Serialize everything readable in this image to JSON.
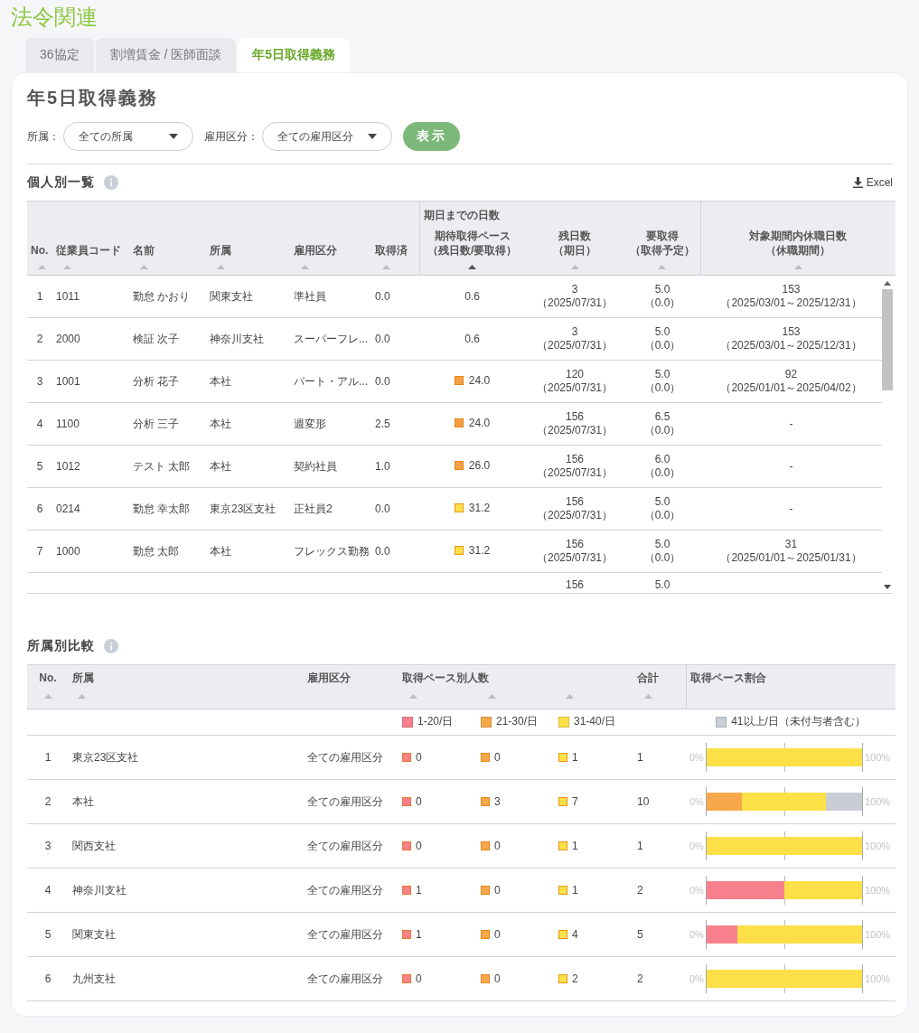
{
  "page_title": "法令関連",
  "tabs": [
    {
      "label": "36協定",
      "selected": false
    },
    {
      "label": "割増賃金 / 医師面談",
      "selected": false
    },
    {
      "label": "年5日取得義務",
      "selected": true
    }
  ],
  "heading": "年5日取得義務",
  "filters": [
    {
      "label": "所属：",
      "value": "全ての所属"
    },
    {
      "label": "雇用区分：",
      "value": "全ての雇用区分"
    }
  ],
  "show_button": "表示",
  "individual": {
    "title": "個人別一覧",
    "export": "Excel",
    "group_header": "期日までの日数",
    "columns": [
      {
        "lines": [
          "No."
        ],
        "sorted": false
      },
      {
        "lines": [
          "従業員コード"
        ],
        "sorted": false
      },
      {
        "lines": [
          "名前"
        ],
        "sorted": false
      },
      {
        "lines": [
          "所属"
        ],
        "sorted": false
      },
      {
        "lines": [
          "雇用区分"
        ],
        "sorted": false
      },
      {
        "lines": [
          "取得済"
        ],
        "sorted": false
      },
      {
        "lines": [
          "期待取得ペース",
          "（残日数/要取得）"
        ],
        "sorted": true
      },
      {
        "lines": [
          "残日数",
          "（期日）"
        ],
        "sorted": false
      },
      {
        "lines": [
          "要取得",
          "（取得予定）"
        ],
        "sorted": false
      },
      {
        "lines": [
          "対象期間内休職日数",
          "（休職期間）"
        ],
        "sorted": false
      }
    ],
    "rows": [
      {
        "no": "1",
        "code": "1011",
        "name": "勤怠 かおり",
        "dept": "関東支社",
        "type": "準社員",
        "taken": "0.0",
        "pace": "0.6",
        "remaining": "3",
        "due": "（2025/07/31）",
        "required": "5.0",
        "planned": "（0.0）",
        "leave_days": "153",
        "leave_period": "（2025/03/01～2025/12/31）"
      },
      {
        "no": "2",
        "code": "2000",
        "name": "検証 次子",
        "dept": "神奈川支社",
        "type": "スーパーフレ...",
        "taken": "0.0",
        "pace": "0.6",
        "remaining": "3",
        "due": "（2025/07/31）",
        "required": "5.0",
        "planned": "（0.0）",
        "leave_days": "153",
        "leave_period": "（2025/03/01～2025/12/31）"
      },
      {
        "no": "3",
        "code": "1001",
        "name": "分析 花子",
        "dept": "本社",
        "type": "パート・アル...",
        "taken": "0.0",
        "pace": "24.0",
        "color": "#f5a044",
        "remaining": "120",
        "due": "（2025/07/31）",
        "required": "5.0",
        "planned": "（0.0）",
        "leave_days": "92",
        "leave_period": "（2025/01/01～2025/04/02）"
      },
      {
        "no": "4",
        "code": "1100",
        "name": "分析 三子",
        "dept": "本社",
        "type": "週変形",
        "taken": "2.5",
        "pace": "24.0",
        "color": "#f5a044",
        "remaining": "156",
        "due": "（2025/07/31）",
        "required": "6.5",
        "planned": "（0.0）",
        "leave_days": "-"
      },
      {
        "no": "5",
        "code": "1012",
        "name": "テスト 太郎",
        "dept": "本社",
        "type": "契約社員",
        "taken": "1.0",
        "pace": "26.0",
        "color": "#f5a044",
        "remaining": "156",
        "due": "（2025/07/31）",
        "required": "6.0",
        "planned": "（0.0）",
        "leave_days": "-"
      },
      {
        "no": "6",
        "code": "0214",
        "name": "勤怠 幸太郎",
        "dept": "東京23区支社",
        "type": "正社員2",
        "taken": "0.0",
        "pace": "31.2",
        "color": "#fde047",
        "remaining": "156",
        "due": "（2025/07/31）",
        "required": "5.0",
        "planned": "（0.0）",
        "leave_days": "-"
      },
      {
        "no": "7",
        "code": "1000",
        "name": "勤怠 太郎",
        "dept": "本社",
        "type": "フレックス勤務",
        "taken": "0.0",
        "pace": "31.2",
        "color": "#fde047",
        "remaining": "156",
        "due": "（2025/07/31）",
        "required": "5.0",
        "planned": "（0.0）",
        "leave_days": "31",
        "leave_period": "（2025/01/01～2025/01/31）"
      },
      {
        "remaining": "156",
        "required": "5.0"
      }
    ]
  },
  "by_department": {
    "title": "所属別比較",
    "columns": [
      {
        "label": "No.",
        "sortable": true
      },
      {
        "label": "所属",
        "sortable": true
      },
      {
        "label": "雇用区分",
        "sortable": false
      },
      {
        "label": "取得ペース別人数",
        "sortable": true
      },
      {
        "sortable": true
      },
      {
        "sortable": true
      },
      {
        "label": "合計",
        "sortable": true
      },
      {
        "label": "取得ペース割合",
        "sortable": false
      }
    ],
    "legend": [
      {
        "label": "1-20/日",
        "color": "#f7808c"
      },
      {
        "label": "21-30/日",
        "color": "#f7a84a"
      },
      {
        "label": "31-40/日",
        "color": "#fde047"
      },
      {
        "label": "41以上/日（未付与者含む）",
        "color": "#c9ced6"
      }
    ],
    "rows": [
      {
        "no": "1",
        "dept": "東京23区支社",
        "type": "全ての雇用区分",
        "counts": [
          "0",
          "0",
          "1"
        ],
        "total": "1",
        "scale_min": "0%",
        "scale_max": "100%",
        "bar": [
          {
            "level": 1,
            "color": "#fde047"
          }
        ]
      },
      {
        "no": "2",
        "dept": "本社",
        "type": "全ての雇用区分",
        "counts": [
          "0",
          "3",
          "7"
        ],
        "total": "10",
        "scale_min": "0%",
        "scale_max": "100%",
        "bar": [
          {
            "level": 0.23,
            "color": "#f7a84a"
          },
          {
            "level": 0.77,
            "color": "#fde047"
          },
          {
            "level": 1,
            "color": "#c9ced6"
          }
        ]
      },
      {
        "no": "3",
        "dept": "関西支社",
        "type": "全ての雇用区分",
        "counts": [
          "0",
          "0",
          "1"
        ],
        "total": "1",
        "scale_min": "0%",
        "scale_max": "100%",
        "bar": [
          {
            "level": 1,
            "color": "#fde047"
          }
        ]
      },
      {
        "no": "4",
        "dept": "神奈川支社",
        "type": "全ての雇用区分",
        "counts": [
          "1",
          "0",
          "1"
        ],
        "total": "2",
        "scale_min": "0%",
        "scale_max": "100%",
        "bar": [
          {
            "level": 0.5,
            "color": "#f7808c"
          },
          {
            "level": 1,
            "color": "#fde047"
          }
        ]
      },
      {
        "no": "5",
        "dept": "関東支社",
        "type": "全ての雇用区分",
        "counts": [
          "1",
          "0",
          "4"
        ],
        "total": "5",
        "scale_min": "0%",
        "scale_max": "100%",
        "bar": [
          {
            "level": 0.2,
            "color": "#f7808c"
          },
          {
            "level": 1,
            "color": "#fde047"
          }
        ]
      },
      {
        "no": "6",
        "dept": "九州支社",
        "type": "全ての雇用区分",
        "counts": [
          "0",
          "0",
          "2"
        ],
        "total": "2",
        "scale_min": "0%",
        "scale_max": "100%",
        "bar": [
          {
            "level": 1,
            "color": "#fde047"
          }
        ]
      }
    ]
  }
}
